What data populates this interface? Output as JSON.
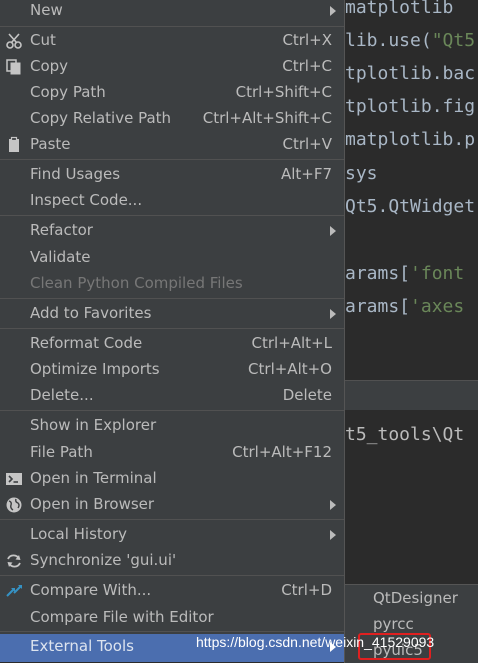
{
  "editor": {
    "lines": [
      {
        "text": "matplotlib"
      },
      {
        "pre": "lib.use(",
        "str": "\"Qt5"
      },
      {
        "text": "tplotlib.bac"
      },
      {
        "text": "tplotlib.fig"
      },
      {
        "text": "matplotlib.p"
      },
      {
        "text": "sys"
      },
      {
        "text": "Qt5.QtWidget"
      },
      {
        "pre": "arams[",
        "str": "'font"
      },
      {
        "pre": "arams[",
        "str": "'axes"
      }
    ],
    "terminal_line": "t5_tools\\Qt"
  },
  "menu": {
    "new": "New",
    "cut": {
      "label": "Cut",
      "shortcut": "Ctrl+X"
    },
    "copy": {
      "label": "Copy",
      "shortcut": "Ctrl+C"
    },
    "copy_path": {
      "label": "Copy Path",
      "shortcut": "Ctrl+Shift+C"
    },
    "copy_relative_path": {
      "label": "Copy Relative Path",
      "shortcut": "Ctrl+Alt+Shift+C"
    },
    "paste": {
      "label": "Paste",
      "shortcut": "Ctrl+V"
    },
    "find_usages": {
      "label": "Find Usages",
      "shortcut": "Alt+F7"
    },
    "inspect_code": "Inspect Code...",
    "refactor": "Refactor",
    "validate": "Validate",
    "clean_python": "Clean Python Compiled Files",
    "add_to_favorites": "Add to Favorites",
    "reformat_code": {
      "label": "Reformat Code",
      "shortcut": "Ctrl+Alt+L"
    },
    "optimize_imports": {
      "label": "Optimize Imports",
      "shortcut": "Ctrl+Alt+O"
    },
    "delete": {
      "label": "Delete...",
      "shortcut": "Delete"
    },
    "show_in_explorer": "Show in Explorer",
    "file_path": {
      "label": "File Path",
      "shortcut": "Ctrl+Alt+F12"
    },
    "open_in_terminal": "Open in Terminal",
    "open_in_browser": "Open in Browser",
    "local_history": "Local History",
    "synchronize": "Synchronize 'gui.ui'",
    "compare_with": {
      "label": "Compare With...",
      "shortcut": "Ctrl+D"
    },
    "compare_file_with_editor": "Compare File with Editor",
    "external_tools": "External Tools"
  },
  "submenu": {
    "items": [
      "QtDesigner",
      "pyrcc",
      "pyuic5"
    ]
  },
  "watermark": "https://blog.csdn.net/weixin_41529093",
  "colors": {
    "menu_bg": "#3c3f41",
    "selected_bg": "#4b6eaf",
    "highlight_border": "#e02020"
  }
}
